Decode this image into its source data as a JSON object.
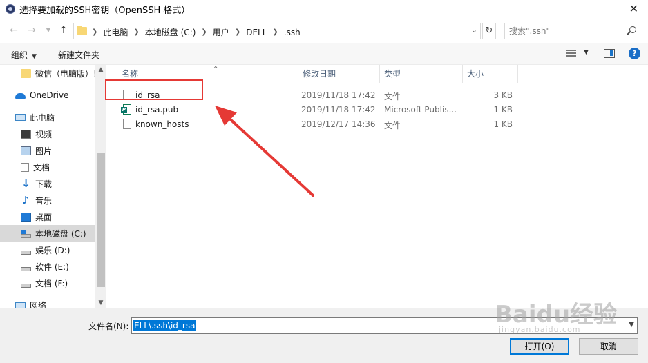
{
  "window": {
    "title": "选择要加载的SSH密钥（OpenSSH 格式）",
    "close_label": "✕"
  },
  "address_bar": {
    "crumbs": [
      "此电脑",
      "本地磁盘 (C:)",
      "用户",
      "DELL",
      ".ssh"
    ],
    "search_placeholder": "搜索\".ssh\""
  },
  "toolbar": {
    "organize_label": "组织",
    "new_folder_label": "新建文件夹",
    "help_label": "?"
  },
  "sidebar": {
    "items": [
      {
        "label": "微信（电脑版）!",
        "icon": "folder-icon"
      },
      {
        "label": "OneDrive",
        "icon": "onedrive-icon"
      },
      {
        "label": "此电脑",
        "icon": "this-pc-icon"
      },
      {
        "label": "视频",
        "icon": "video-icon"
      },
      {
        "label": "图片",
        "icon": "picture-icon"
      },
      {
        "label": "文档",
        "icon": "document-icon"
      },
      {
        "label": "下载",
        "icon": "download-icon"
      },
      {
        "label": "音乐",
        "icon": "music-icon"
      },
      {
        "label": "桌面",
        "icon": "desktop-icon"
      },
      {
        "label": "本地磁盘 (C:)",
        "icon": "drive-c-icon"
      },
      {
        "label": "娱乐 (D:)",
        "icon": "drive-icon"
      },
      {
        "label": "软件 (E:)",
        "icon": "drive-icon"
      },
      {
        "label": "文档 (F:)",
        "icon": "drive-icon"
      },
      {
        "label": "网络",
        "icon": "network-icon"
      }
    ],
    "selected_item": "本地磁盘 (C:)"
  },
  "file_list": {
    "columns": [
      "名称",
      "修改日期",
      "类型",
      "大小"
    ],
    "rows": [
      {
        "name": "id_rsa",
        "date": "2019/11/18 17:42",
        "type": "文件",
        "size": "3 KB",
        "icon": "file-icon"
      },
      {
        "name": "id_rsa.pub",
        "date": "2019/11/18 17:42",
        "type": "Microsoft Publis...",
        "size": "1 KB",
        "icon": "publisher-file-icon"
      },
      {
        "name": "known_hosts",
        "date": "2019/12/17 14:36",
        "type": "文件",
        "size": "1 KB",
        "icon": "file-icon"
      }
    ]
  },
  "footer": {
    "filename_label": "文件名(N):",
    "filename_value": "ELL\\.ssh\\id_rsa",
    "open_label": "打开(O)",
    "cancel_label": "取消"
  },
  "annotation_colors": {
    "highlight": "#e53935",
    "accent": "#0078d7"
  },
  "watermark": {
    "text": "Baidu经验",
    "sub": "jingyan.baidu.com"
  }
}
